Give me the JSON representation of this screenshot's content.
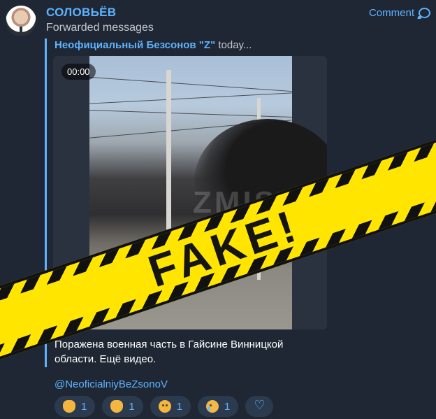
{
  "header": {
    "channel_name": "СОЛОВЬЁВ",
    "subtitle": "Forwarded messages",
    "comment_label": "Comment"
  },
  "forward": {
    "source_name": "Неофициальный Безсонов \"Z\"",
    "source_time": "today..."
  },
  "video": {
    "duration": "00:00",
    "watermark": "ZMIST"
  },
  "overlay": {
    "stamp_text": "FAKE!"
  },
  "message": {
    "text": "Поражена военная часть в Гайсине Винницкой области. Ещё видео.",
    "mention": "@NeoficialniyBeZsonoV"
  },
  "reactions": [
    {
      "emoji": "thumbs-up",
      "count": "1"
    },
    {
      "emoji": "clapping-hands",
      "count": "1"
    },
    {
      "emoji": "thinking-face",
      "count": "1"
    },
    {
      "emoji": "crying-face",
      "count": "1"
    }
  ],
  "colors": {
    "background": "#1e2733",
    "accent": "#5eb3ff",
    "stamp_yellow": "#ffe500"
  }
}
